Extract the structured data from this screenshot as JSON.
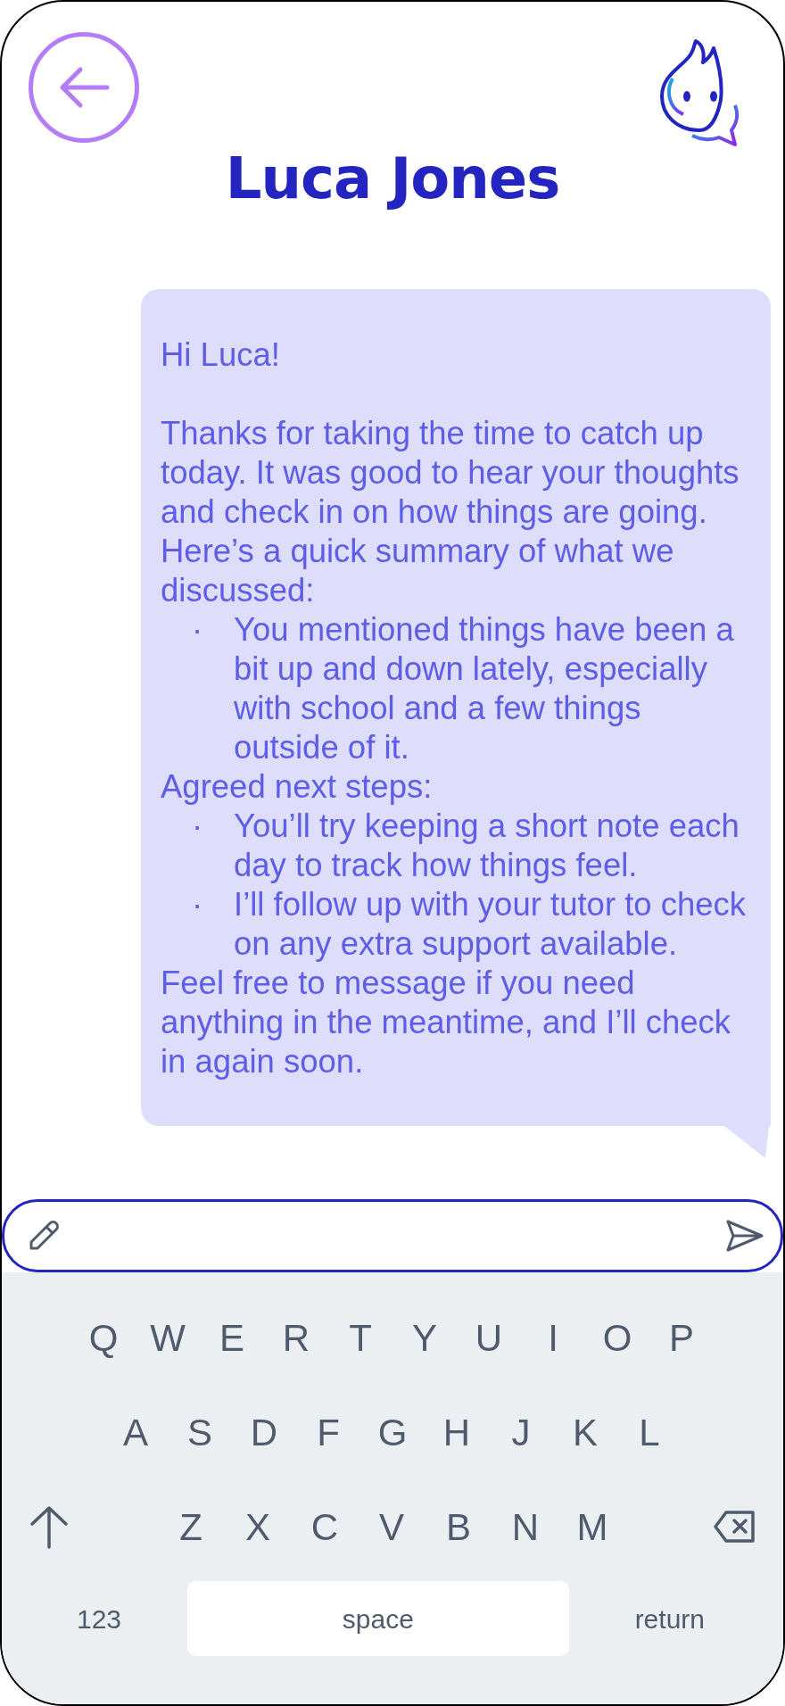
{
  "header": {
    "title": "Luca Jones"
  },
  "message": {
    "blocks": [
      {
        "kind": "greeting",
        "text": "Hi Luca!"
      },
      {
        "kind": "paragraph",
        "text": "Thanks for taking the time to catch up today. It was good to hear your thoughts and check in on how things are going. Here’s a quick summary of what we discussed:"
      },
      {
        "kind": "bullets",
        "items": [
          "·"
        ],
        "texts": [
          "You mentioned things have been a bit up and down lately, especially with school and a few things outside of it."
        ]
      },
      {
        "kind": "paragraph",
        "text": "Agreed next steps:"
      },
      {
        "kind": "bullets",
        "items": [
          "·",
          "·"
        ],
        "texts": [
          "You’ll try keeping a short note each day to track how things feel.",
          "I’ll follow up with your tutor to check on any extra support available."
        ]
      },
      {
        "kind": "paragraph",
        "text": "Feel free to message if you need anything in the meantime, and I’ll check in again soon."
      }
    ]
  },
  "keyboard": {
    "rows": [
      [
        "Q",
        "W",
        "E",
        "R",
        "T",
        "Y",
        "U",
        "I",
        "O",
        "P"
      ],
      [
        "A",
        "S",
        "D",
        "F",
        "G",
        "H",
        "J",
        "K",
        "L"
      ],
      [
        "Z",
        "X",
        "C",
        "V",
        "B",
        "N",
        "M"
      ]
    ],
    "bottom": {
      "numbers": "123",
      "space": "space",
      "return": "return"
    }
  }
}
